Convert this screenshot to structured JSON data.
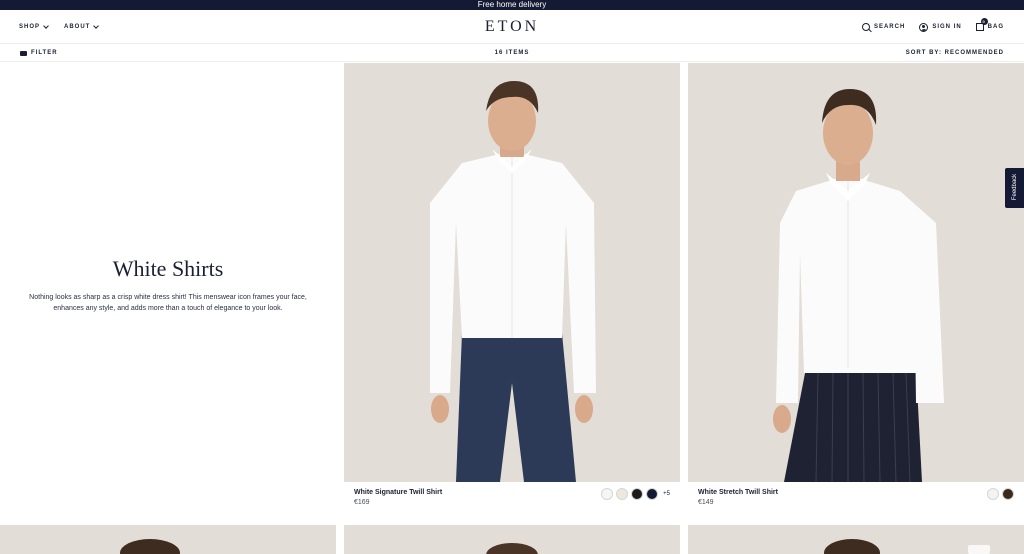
{
  "banner": {
    "text": "Free home delivery"
  },
  "header": {
    "nav": [
      {
        "label": "SHOP"
      },
      {
        "label": "ABOUT"
      }
    ],
    "logo": "ETON",
    "search": "SEARCH",
    "sign_in": "SIGN IN",
    "bag": "BAG",
    "bag_count": "0"
  },
  "toolbar": {
    "filter": "FILTER",
    "items": "16 ITEMS",
    "sort": "SORT BY: RECOMMENDED"
  },
  "intro": {
    "title": "White Shirts",
    "text": "Nothing looks as sharp as a crisp white dress shirt! This menswear icon frames your face, enhances any style, and adds more than a touch of elegance to your look."
  },
  "products": [
    {
      "name": "White Signature Twill Shirt",
      "price": "€169",
      "swatches": [
        "#f6f6f6",
        "#ede7dc",
        "#1c1c1c",
        "#141a33"
      ],
      "more": "+5",
      "trousers": "#2c3a58"
    },
    {
      "name": "White Stretch Twill Shirt",
      "price": "€149",
      "swatches": [
        "#f3f3f3",
        "#3a2a1c"
      ],
      "more": "",
      "trousers": "#1f2233"
    }
  ],
  "feedback": "Feedback",
  "colors": {
    "navy": "#141a33",
    "image_bg": "#e2ddd6"
  }
}
